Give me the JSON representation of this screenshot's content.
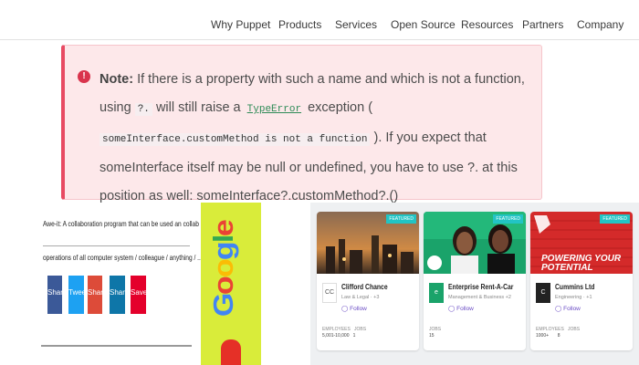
{
  "nav": {
    "items": [
      "Why Puppet",
      "Products",
      "Services",
      "Open Source",
      "Resources",
      "Partners",
      "Company"
    ]
  },
  "note": {
    "icon": "exclamation-icon",
    "label": "Note:",
    "t1": "If there is a property with such a name and which is not a function, using",
    "c1": "?.",
    "t2": "will still raise a",
    "c2": "TypeError",
    "t3": "exception (",
    "c3": "someInterface.customMethod is not a function",
    "t4": "). If you expect that someInterface itself may be null or undefined, you have to use ?. at this position as well: someInterface?.customMethod?.()",
    "colors": {
      "bg": "#fde8ea",
      "accent": "#e84b63"
    }
  },
  "ad_left": {
    "line1": "Awe-it: A collaboration program that can be used an collab interact to screen",
    "line2": "operations of all computer system / colleague / anything / ...",
    "shares": [
      "Share",
      "Tweet",
      "Share",
      "Share",
      "Save"
    ]
  },
  "ad_google": {
    "word": "Google",
    "letter_colors": [
      "#4285f4",
      "#ea4335",
      "#fbbc05",
      "#4285f4",
      "#34a853",
      "#ea4335"
    ]
  },
  "cards": [
    {
      "badge": "FEATURED",
      "name": "Clifford Chance",
      "sector": "Law & Legal · +3",
      "follow": "Follow",
      "stats": {
        "k1": "EMPLOYEES",
        "v1": "5,001-10,000",
        "k2": "JOBS",
        "v2": "1"
      },
      "logo": "CC"
    },
    {
      "badge": "FEATURED",
      "name": "Enterprise Rent-A-Car",
      "sector": "Management & Business +2",
      "follow": "Follow",
      "stats": {
        "k1": "JOBS",
        "v1": "15",
        "k2": "",
        "v2": ""
      },
      "logo": "e"
    },
    {
      "badge": "FEATURED",
      "name": "Cummins Ltd",
      "sector": "Engineering · +1",
      "follow": "Follow",
      "stats": {
        "k1": "EMPLOYEES",
        "v1": "1000+",
        "k2": "JOBS",
        "v2": "8"
      },
      "logo": "C",
      "tagline": "POWERING YOUR POTENTIAL"
    }
  ]
}
